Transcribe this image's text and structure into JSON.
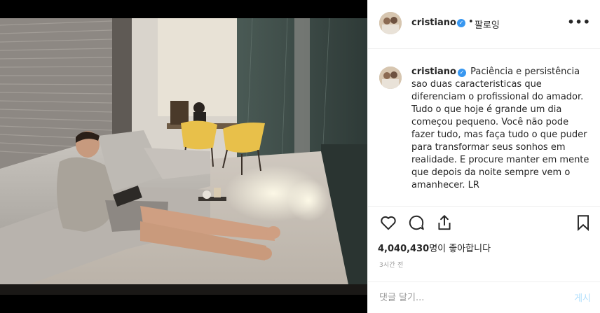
{
  "header": {
    "username": "cristiano",
    "separator": "•",
    "follow_label": "팔로잉",
    "more_label": "•••"
  },
  "post": {
    "caption_user": "cristiano",
    "caption": "Paciência e persistência sao duas caracteristicas que diferenciam o profissional do amador. Tudo o que hoje é grande um dia começou pequeno. Você não pode fazer tudo, mas faça tudo o que puder para transformar seus sonhos em realidade. E procure manter em mente que depois da noite sempre vem o amanhecer. LR",
    "likes_count": "4,040,430",
    "likes_suffix": "명이 좋아합니다",
    "time": "3시간 전"
  },
  "comment": {
    "placeholder": "댓글 달기...",
    "post_label": "게시"
  },
  "icons": {
    "verified": "verified-badge-icon",
    "like": "heart-icon",
    "comment": "comment-bubble-icon",
    "share": "share-upload-icon",
    "save": "bookmark-icon",
    "more": "more-dots-icon"
  },
  "colors": {
    "verified_blue": "#3897f0",
    "post_button_disabled": "#b2dffc",
    "meta_gray": "#999999",
    "divider": "#efefef"
  }
}
